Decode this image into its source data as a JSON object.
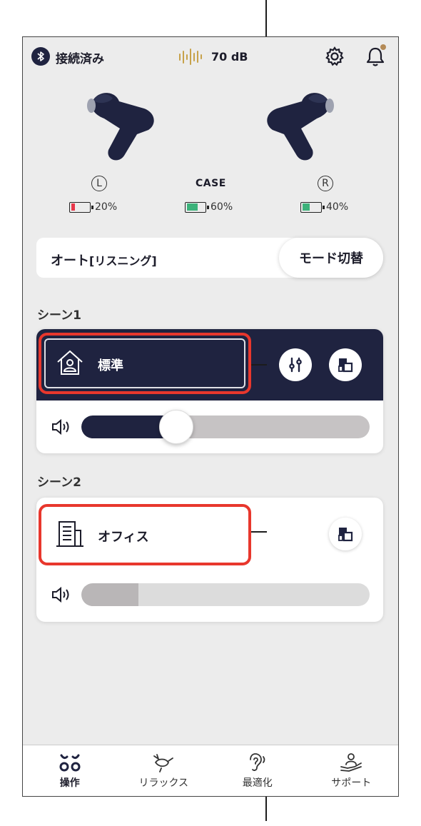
{
  "status": {
    "connection_text": "接続済み",
    "noise_level": "70 dB",
    "icons": [
      "bluetooth-icon",
      "sound-level-icon",
      "gear-icon",
      "bell-icon"
    ],
    "bell_dot_color": "#b48a56"
  },
  "earbuds": {
    "left": {
      "label": "L",
      "battery": "20%",
      "battery_level": 0.2,
      "battery_color": "#e8374a"
    },
    "case": {
      "label": "CASE",
      "battery": "60%",
      "battery_level": 0.6,
      "battery_color": "#3cb27a"
    },
    "right": {
      "label": "R",
      "battery": "40%",
      "battery_level": 0.4,
      "battery_color": "#3cb27a"
    }
  },
  "mode": {
    "current_label": "オート",
    "current_sub": "[リスニング]",
    "switch_button": "モード切替"
  },
  "scenes": [
    {
      "heading": "シーン1",
      "name": "標準",
      "icon": "home-person-icon",
      "selected": true,
      "volume_level": 0.3,
      "buttons": [
        "equalizer-icon",
        "scene-switch-icon"
      ]
    },
    {
      "heading": "シーン2",
      "name": "オフィス",
      "icon": "office-building-icon",
      "selected": true,
      "volume_level": 0.2,
      "buttons": [
        "scene-switch-icon"
      ]
    }
  ],
  "tabs": [
    {
      "label": "操作",
      "icon": "control-icon",
      "active": true
    },
    {
      "label": "リラックス",
      "icon": "bird-icon",
      "active": false
    },
    {
      "label": "最適化",
      "icon": "ear-icon",
      "active": false
    },
    {
      "label": "サポート",
      "icon": "support-icon",
      "active": false
    }
  ],
  "colors": {
    "navy": "#1f2340",
    "highlight_red": "#e8372d",
    "slider_inactive": "#c6c3c4",
    "background": "#ececec"
  }
}
